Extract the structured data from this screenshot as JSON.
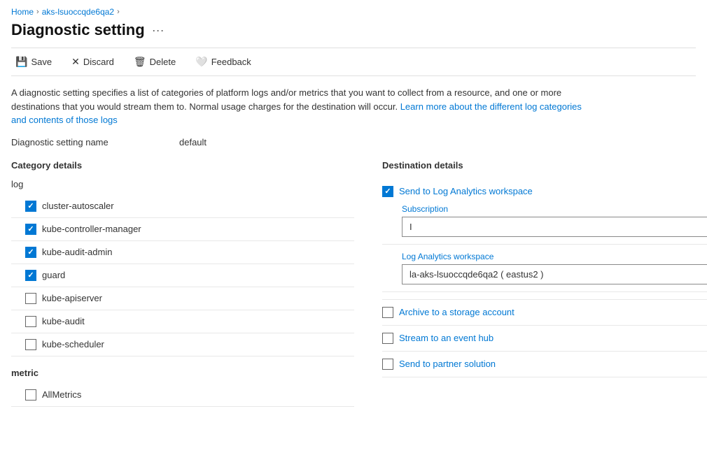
{
  "breadcrumb": {
    "home": "Home",
    "resource": "aks-lsuoccqde6qa2"
  },
  "page": {
    "title": "Diagnostic setting",
    "more_icon": "···"
  },
  "toolbar": {
    "save": "Save",
    "discard": "Discard",
    "delete": "Delete",
    "feedback": "Feedback"
  },
  "description": {
    "text1": "A diagnostic setting specifies a list of categories of platform logs and/or metrics that you want to collect from a resource, and one or more destinations that you would stream them to. Normal usage charges for the destination will occur. ",
    "link_text": "Learn more about the different log categories and contents of those logs",
    "link_href": "#"
  },
  "setting_name": {
    "label": "Diagnostic setting name",
    "value": "default"
  },
  "left_section": {
    "title": "Category details",
    "log_group_label": "log",
    "categories": [
      {
        "id": "cluster-autoscaler",
        "label": "cluster-autoscaler",
        "checked": true
      },
      {
        "id": "kube-controller-manager",
        "label": "kube-controller-manager",
        "checked": true
      },
      {
        "id": "kube-audit-admin",
        "label": "kube-audit-admin",
        "checked": true
      },
      {
        "id": "guard",
        "label": "guard",
        "checked": true
      },
      {
        "id": "kube-apiserver",
        "label": "kube-apiserver",
        "checked": false
      },
      {
        "id": "kube-audit",
        "label": "kube-audit",
        "checked": false
      },
      {
        "id": "kube-scheduler",
        "label": "kube-scheduler",
        "checked": false
      }
    ],
    "metric_group_label": "metric",
    "metrics": [
      {
        "id": "AllMetrics",
        "label": "AllMetrics",
        "checked": false
      }
    ]
  },
  "right_section": {
    "title": "Destination details",
    "send_to_log_analytics": {
      "label": "Send to Log Analytics workspace",
      "checked": true
    },
    "subscription_label": "Subscription",
    "subscription_value": "I",
    "log_analytics_label": "Log Analytics workspace",
    "log_analytics_value": "la-aks-lsuoccqde6qa2 ( eastus2 )",
    "destinations": [
      {
        "id": "archive",
        "label": "Archive to a storage account",
        "checked": false
      },
      {
        "id": "stream",
        "label": "Stream to an event hub",
        "checked": false
      },
      {
        "id": "partner",
        "label": "Send to partner solution",
        "checked": false
      }
    ]
  }
}
